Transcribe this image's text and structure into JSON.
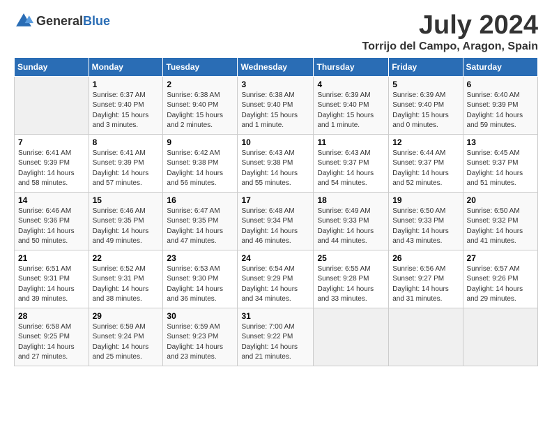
{
  "logo": {
    "text_general": "General",
    "text_blue": "Blue"
  },
  "title": "July 2024",
  "location": "Torrijo del Campo, Aragon, Spain",
  "days_of_week": [
    "Sunday",
    "Monday",
    "Tuesday",
    "Wednesday",
    "Thursday",
    "Friday",
    "Saturday"
  ],
  "weeks": [
    [
      {
        "day": "",
        "info": ""
      },
      {
        "day": "1",
        "info": "Sunrise: 6:37 AM\nSunset: 9:40 PM\nDaylight: 15 hours\nand 3 minutes."
      },
      {
        "day": "2",
        "info": "Sunrise: 6:38 AM\nSunset: 9:40 PM\nDaylight: 15 hours\nand 2 minutes."
      },
      {
        "day": "3",
        "info": "Sunrise: 6:38 AM\nSunset: 9:40 PM\nDaylight: 15 hours\nand 1 minute."
      },
      {
        "day": "4",
        "info": "Sunrise: 6:39 AM\nSunset: 9:40 PM\nDaylight: 15 hours\nand 1 minute."
      },
      {
        "day": "5",
        "info": "Sunrise: 6:39 AM\nSunset: 9:40 PM\nDaylight: 15 hours\nand 0 minutes."
      },
      {
        "day": "6",
        "info": "Sunrise: 6:40 AM\nSunset: 9:39 PM\nDaylight: 14 hours\nand 59 minutes."
      }
    ],
    [
      {
        "day": "7",
        "info": "Sunrise: 6:41 AM\nSunset: 9:39 PM\nDaylight: 14 hours\nand 58 minutes."
      },
      {
        "day": "8",
        "info": "Sunrise: 6:41 AM\nSunset: 9:39 PM\nDaylight: 14 hours\nand 57 minutes."
      },
      {
        "day": "9",
        "info": "Sunrise: 6:42 AM\nSunset: 9:38 PM\nDaylight: 14 hours\nand 56 minutes."
      },
      {
        "day": "10",
        "info": "Sunrise: 6:43 AM\nSunset: 9:38 PM\nDaylight: 14 hours\nand 55 minutes."
      },
      {
        "day": "11",
        "info": "Sunrise: 6:43 AM\nSunset: 9:37 PM\nDaylight: 14 hours\nand 54 minutes."
      },
      {
        "day": "12",
        "info": "Sunrise: 6:44 AM\nSunset: 9:37 PM\nDaylight: 14 hours\nand 52 minutes."
      },
      {
        "day": "13",
        "info": "Sunrise: 6:45 AM\nSunset: 9:37 PM\nDaylight: 14 hours\nand 51 minutes."
      }
    ],
    [
      {
        "day": "14",
        "info": "Sunrise: 6:46 AM\nSunset: 9:36 PM\nDaylight: 14 hours\nand 50 minutes."
      },
      {
        "day": "15",
        "info": "Sunrise: 6:46 AM\nSunset: 9:35 PM\nDaylight: 14 hours\nand 49 minutes."
      },
      {
        "day": "16",
        "info": "Sunrise: 6:47 AM\nSunset: 9:35 PM\nDaylight: 14 hours\nand 47 minutes."
      },
      {
        "day": "17",
        "info": "Sunrise: 6:48 AM\nSunset: 9:34 PM\nDaylight: 14 hours\nand 46 minutes."
      },
      {
        "day": "18",
        "info": "Sunrise: 6:49 AM\nSunset: 9:33 PM\nDaylight: 14 hours\nand 44 minutes."
      },
      {
        "day": "19",
        "info": "Sunrise: 6:50 AM\nSunset: 9:33 PM\nDaylight: 14 hours\nand 43 minutes."
      },
      {
        "day": "20",
        "info": "Sunrise: 6:50 AM\nSunset: 9:32 PM\nDaylight: 14 hours\nand 41 minutes."
      }
    ],
    [
      {
        "day": "21",
        "info": "Sunrise: 6:51 AM\nSunset: 9:31 PM\nDaylight: 14 hours\nand 39 minutes."
      },
      {
        "day": "22",
        "info": "Sunrise: 6:52 AM\nSunset: 9:31 PM\nDaylight: 14 hours\nand 38 minutes."
      },
      {
        "day": "23",
        "info": "Sunrise: 6:53 AM\nSunset: 9:30 PM\nDaylight: 14 hours\nand 36 minutes."
      },
      {
        "day": "24",
        "info": "Sunrise: 6:54 AM\nSunset: 9:29 PM\nDaylight: 14 hours\nand 34 minutes."
      },
      {
        "day": "25",
        "info": "Sunrise: 6:55 AM\nSunset: 9:28 PM\nDaylight: 14 hours\nand 33 minutes."
      },
      {
        "day": "26",
        "info": "Sunrise: 6:56 AM\nSunset: 9:27 PM\nDaylight: 14 hours\nand 31 minutes."
      },
      {
        "day": "27",
        "info": "Sunrise: 6:57 AM\nSunset: 9:26 PM\nDaylight: 14 hours\nand 29 minutes."
      }
    ],
    [
      {
        "day": "28",
        "info": "Sunrise: 6:58 AM\nSunset: 9:25 PM\nDaylight: 14 hours\nand 27 minutes."
      },
      {
        "day": "29",
        "info": "Sunrise: 6:59 AM\nSunset: 9:24 PM\nDaylight: 14 hours\nand 25 minutes."
      },
      {
        "day": "30",
        "info": "Sunrise: 6:59 AM\nSunset: 9:23 PM\nDaylight: 14 hours\nand 23 minutes."
      },
      {
        "day": "31",
        "info": "Sunrise: 7:00 AM\nSunset: 9:22 PM\nDaylight: 14 hours\nand 21 minutes."
      },
      {
        "day": "",
        "info": ""
      },
      {
        "day": "",
        "info": ""
      },
      {
        "day": "",
        "info": ""
      }
    ]
  ]
}
